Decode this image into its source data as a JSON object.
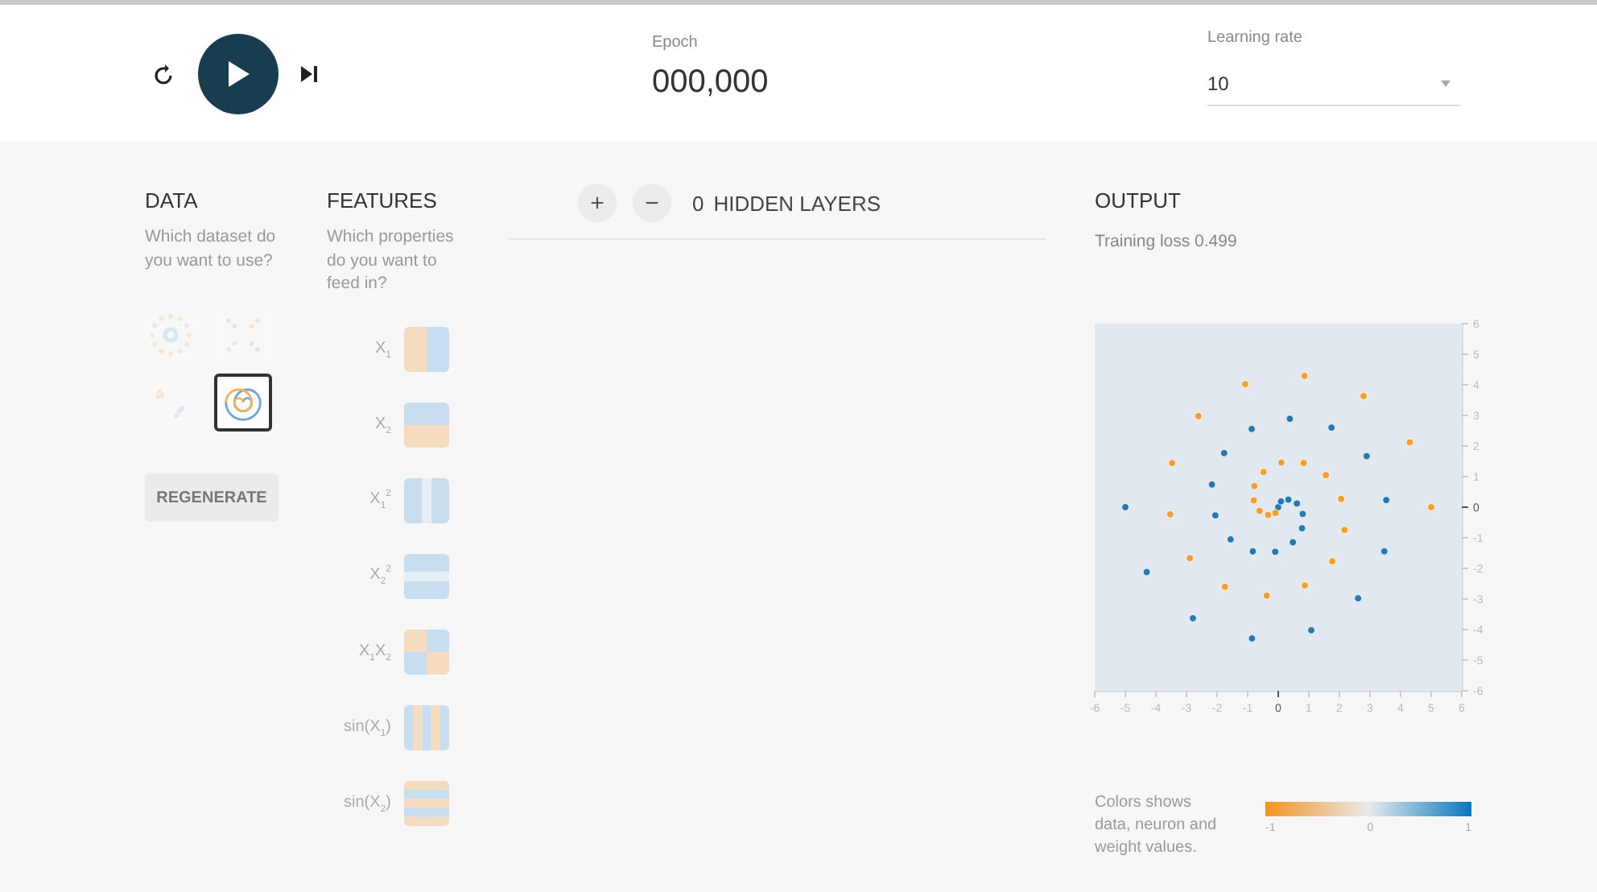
{
  "header": {
    "controls": [
      {
        "kind": "reset"
      },
      {
        "kind": "play"
      },
      {
        "kind": "step"
      }
    ],
    "epoch": {
      "label": "Epoch",
      "value": "000,000"
    },
    "learning_rate": {
      "label": "Learning rate",
      "value": "10"
    }
  },
  "data": {
    "title": "DATA",
    "description": "Which dataset do you want to use?",
    "datasets": [
      {
        "kind": "circle",
        "selected": false
      },
      {
        "kind": "xor",
        "selected": false
      },
      {
        "kind": "gauss",
        "selected": false
      },
      {
        "kind": "spiral",
        "selected": true
      }
    ],
    "regenerate": "REGENERATE"
  },
  "features": {
    "title": "FEATURES",
    "description": "Which properties do you want to feed in?",
    "items": [
      {
        "label": "X$_{1}$",
        "kind": "x1",
        "selected": false
      },
      {
        "label": "X$_{2}$",
        "kind": "x2",
        "selected": false
      },
      {
        "label": "X$_{1}$$^{2}$",
        "kind": "x1sq",
        "selected": false
      },
      {
        "label": "X$_{2}$$^{2}$",
        "kind": "x2sq",
        "selected": false
      },
      {
        "label": "X$_{1}$X$_{2}$",
        "kind": "x1x2",
        "selected": false
      },
      {
        "label": "sin(X$_{1}$)",
        "kind": "sinx1",
        "selected": false
      },
      {
        "label": "sin(X$_{2}$)",
        "kind": "sinx2",
        "selected": false
      }
    ]
  },
  "network": {
    "add": "+",
    "remove": "−",
    "count": "0",
    "label": "HIDDEN LAYERS"
  },
  "output": {
    "title": "OUTPUT",
    "loss": "Training loss 0.499",
    "chart_data": {
      "type": "scatter",
      "xlim": [
        -6,
        6
      ],
      "ylim": [
        -6,
        6
      ],
      "xticks": [
        -6,
        -5,
        -4,
        -3,
        -2,
        -1,
        0,
        1,
        2,
        3,
        4,
        5,
        6
      ],
      "yticks": [
        -6,
        -5,
        -4,
        -3,
        -2,
        -1,
        0,
        1,
        2,
        3,
        4,
        5,
        6
      ],
      "x": [
        0,
        0.09,
        0.33,
        0.61,
        0.8,
        0.78,
        0.48,
        -0.1,
        -0.83,
        -1.56,
        -2.06,
        -2.17,
        -1.77,
        -0.87,
        0.38,
        1.74,
        2.89,
        3.53,
        3.47,
        2.61,
        1.08,
        -0.86,
        -2.79,
        -4.3,
        -5,
        -0.09,
        -0.33,
        -0.61,
        -0.8,
        -0.78,
        -0.48,
        0.1,
        0.83,
        1.56,
        2.06,
        2.17,
        1.77,
        0.87,
        -0.38,
        -1.74,
        -2.89,
        -3.53,
        -3.47,
        -2.61,
        -1.08,
        0.86,
        2.79,
        4.3,
        5
      ],
      "series": [
        {
          "color": "#2478b4",
          "values": [
            0,
            0.19,
            0.25,
            0.12,
            -0.22,
            -0.69,
            -1.15,
            -1.46,
            -1.44,
            -1.05,
            -0.27,
            0.74,
            1.77,
            2.56,
            2.89,
            2.6,
            1.67,
            0.23,
            -1.44,
            -2.98,
            -4.02,
            -4.29,
            -3.63,
            -2.12,
            0,
            null,
            null,
            null,
            null,
            null,
            null,
            null,
            null,
            null,
            null,
            null,
            null,
            null,
            null,
            null,
            null,
            null,
            null,
            null,
            null,
            null,
            null,
            null,
            null
          ]
        },
        {
          "color": "#f59e2c",
          "values": [
            null,
            null,
            null,
            null,
            null,
            null,
            null,
            null,
            null,
            null,
            null,
            null,
            null,
            null,
            null,
            null,
            null,
            null,
            null,
            null,
            null,
            null,
            null,
            null,
            null,
            -0.19,
            -0.25,
            -0.12,
            0.22,
            0.69,
            1.15,
            1.46,
            1.44,
            1.05,
            0.27,
            -0.74,
            -1.77,
            -2.56,
            -2.89,
            -2.6,
            -1.67,
            -0.23,
            1.44,
            2.98,
            4.02,
            4.29,
            3.63,
            2.12,
            0
          ]
        }
      ]
    },
    "legend": {
      "text": "Colors shows data, neuron and weight values.",
      "ticks": [
        "-1",
        "0",
        "1"
      ]
    }
  }
}
